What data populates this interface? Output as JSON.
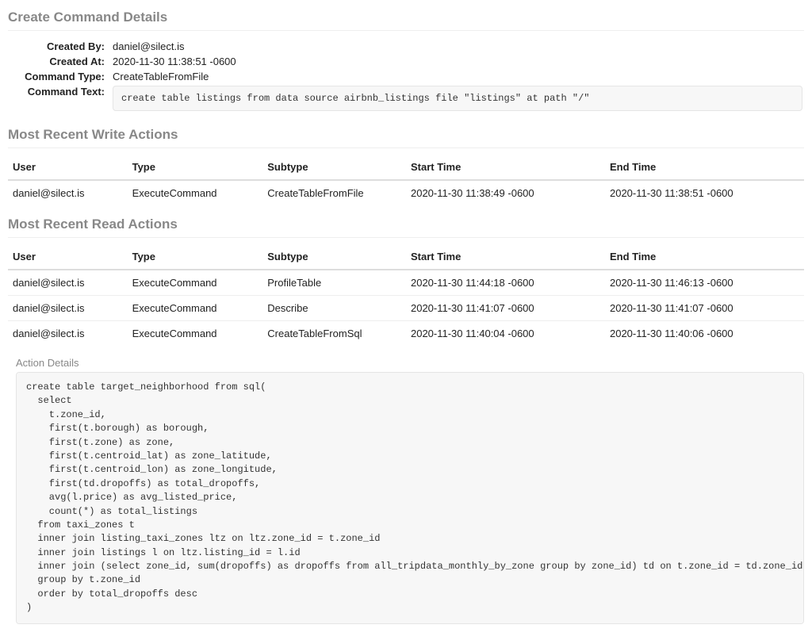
{
  "sections": {
    "create_title": "Create Command Details",
    "write_title": "Most Recent Write Actions",
    "read_title": "Most Recent Read Actions",
    "action_details_label": "Action Details"
  },
  "command_details": {
    "labels": {
      "created_by": "Created By:",
      "created_at": "Created At:",
      "command_type": "Command Type:",
      "command_text": "Command Text:"
    },
    "values": {
      "created_by": "daniel@silect.is",
      "created_at": "2020-11-30 11:38:51 -0600",
      "command_type": "CreateTableFromFile",
      "command_text": "create table listings from data source airbnb_listings file \"listings\" at path \"/\""
    }
  },
  "table_headers": {
    "user": "User",
    "type": "Type",
    "subtype": "Subtype",
    "start": "Start Time",
    "end": "End Time"
  },
  "write_actions": [
    {
      "user": "daniel@silect.is",
      "type": "ExecuteCommand",
      "subtype": "CreateTableFromFile",
      "start": "2020-11-30 11:38:49 -0600",
      "end": "2020-11-30 11:38:51 -0600"
    }
  ],
  "read_actions": [
    {
      "user": "daniel@silect.is",
      "type": "ExecuteCommand",
      "subtype": "ProfileTable",
      "start": "2020-11-30 11:44:18 -0600",
      "end": "2020-11-30 11:46:13 -0600"
    },
    {
      "user": "daniel@silect.is",
      "type": "ExecuteCommand",
      "subtype": "Describe",
      "start": "2020-11-30 11:41:07 -0600",
      "end": "2020-11-30 11:41:07 -0600"
    },
    {
      "user": "daniel@silect.is",
      "type": "ExecuteCommand",
      "subtype": "CreateTableFromSql",
      "start": "2020-11-30 11:40:04 -0600",
      "end": "2020-11-30 11:40:06 -0600"
    }
  ],
  "action_sql": "create table target_neighborhood from sql(\n  select\n    t.zone_id,\n    first(t.borough) as borough,\n    first(t.zone) as zone,\n    first(t.centroid_lat) as zone_latitude,\n    first(t.centroid_lon) as zone_longitude,\n    first(td.dropoffs) as total_dropoffs,\n    avg(l.price) as avg_listed_price,\n    count(*) as total_listings\n  from taxi_zones t\n  inner join listing_taxi_zones ltz on ltz.zone_id = t.zone_id\n  inner join listings l on ltz.listing_id = l.id\n  inner join (select zone_id, sum(dropoffs) as dropoffs from all_tripdata_monthly_by_zone group by zone_id) td on t.zone_id = td.zone_id\n  group by t.zone_id\n  order by total_dropoffs desc\n)"
}
